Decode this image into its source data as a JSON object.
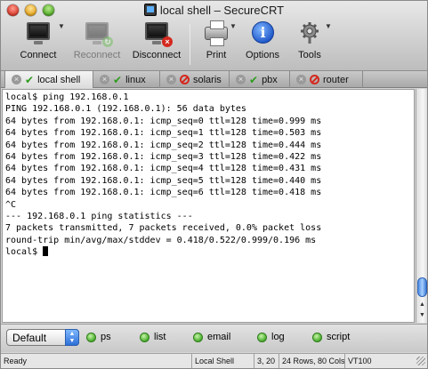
{
  "window": {
    "title": "local shell – SecureCRT"
  },
  "toolbar": {
    "items": [
      {
        "label": "Connect",
        "icon": "monitor-icon",
        "enabled": true,
        "has_menu": true
      },
      {
        "label": "Reconnect",
        "icon": "reconnect-icon",
        "enabled": false,
        "has_menu": false
      },
      {
        "label": "Disconnect",
        "icon": "disconnect-icon",
        "enabled": true,
        "has_menu": false
      },
      {
        "label": "Print",
        "icon": "printer-icon",
        "enabled": true,
        "has_menu": true
      },
      {
        "label": "Options",
        "icon": "info-icon",
        "enabled": true,
        "has_menu": false
      },
      {
        "label": "Tools",
        "icon": "gear-icon",
        "enabled": true,
        "has_menu": true
      }
    ]
  },
  "tabs": [
    {
      "label": "local shell",
      "status": "connected",
      "active": true
    },
    {
      "label": "linux",
      "status": "connected",
      "active": false
    },
    {
      "label": "solaris",
      "status": "disconnected",
      "active": false
    },
    {
      "label": "pbx",
      "status": "connected",
      "active": false
    },
    {
      "label": "router",
      "status": "disconnected",
      "active": false
    }
  ],
  "terminal": {
    "lines": [
      "local$ ping 192.168.0.1",
      "PING 192.168.0.1 (192.168.0.1): 56 data bytes",
      "64 bytes from 192.168.0.1: icmp_seq=0 ttl=128 time=0.999 ms",
      "64 bytes from 192.168.0.1: icmp_seq=1 ttl=128 time=0.503 ms",
      "64 bytes from 192.168.0.1: icmp_seq=2 ttl=128 time=0.444 ms",
      "64 bytes from 192.168.0.1: icmp_seq=3 ttl=128 time=0.422 ms",
      "64 bytes from 192.168.0.1: icmp_seq=4 ttl=128 time=0.431 ms",
      "64 bytes from 192.168.0.1: icmp_seq=5 ttl=128 time=0.440 ms",
      "64 bytes from 192.168.0.1: icmp_seq=6 ttl=128 time=0.418 ms",
      "^C",
      "--- 192.168.0.1 ping statistics ---",
      "7 packets transmitted, 7 packets received, 0.0% packet loss",
      "round-trip min/avg/max/stddev = 0.418/0.522/0.999/0.196 ms"
    ],
    "prompt": "local$ "
  },
  "button_bar": {
    "selected": "Default",
    "buttons": [
      "ps",
      "list",
      "email",
      "log",
      "script"
    ]
  },
  "status_bar": {
    "state": "Ready",
    "session": "Local Shell",
    "position": "3, 20",
    "size": "24 Rows, 80 Cols",
    "emulation": "VT100"
  },
  "colors": {
    "connected": "#2e9b1f",
    "disconnected": "#d4281e",
    "scroll_thumb": "#4c8de6"
  }
}
